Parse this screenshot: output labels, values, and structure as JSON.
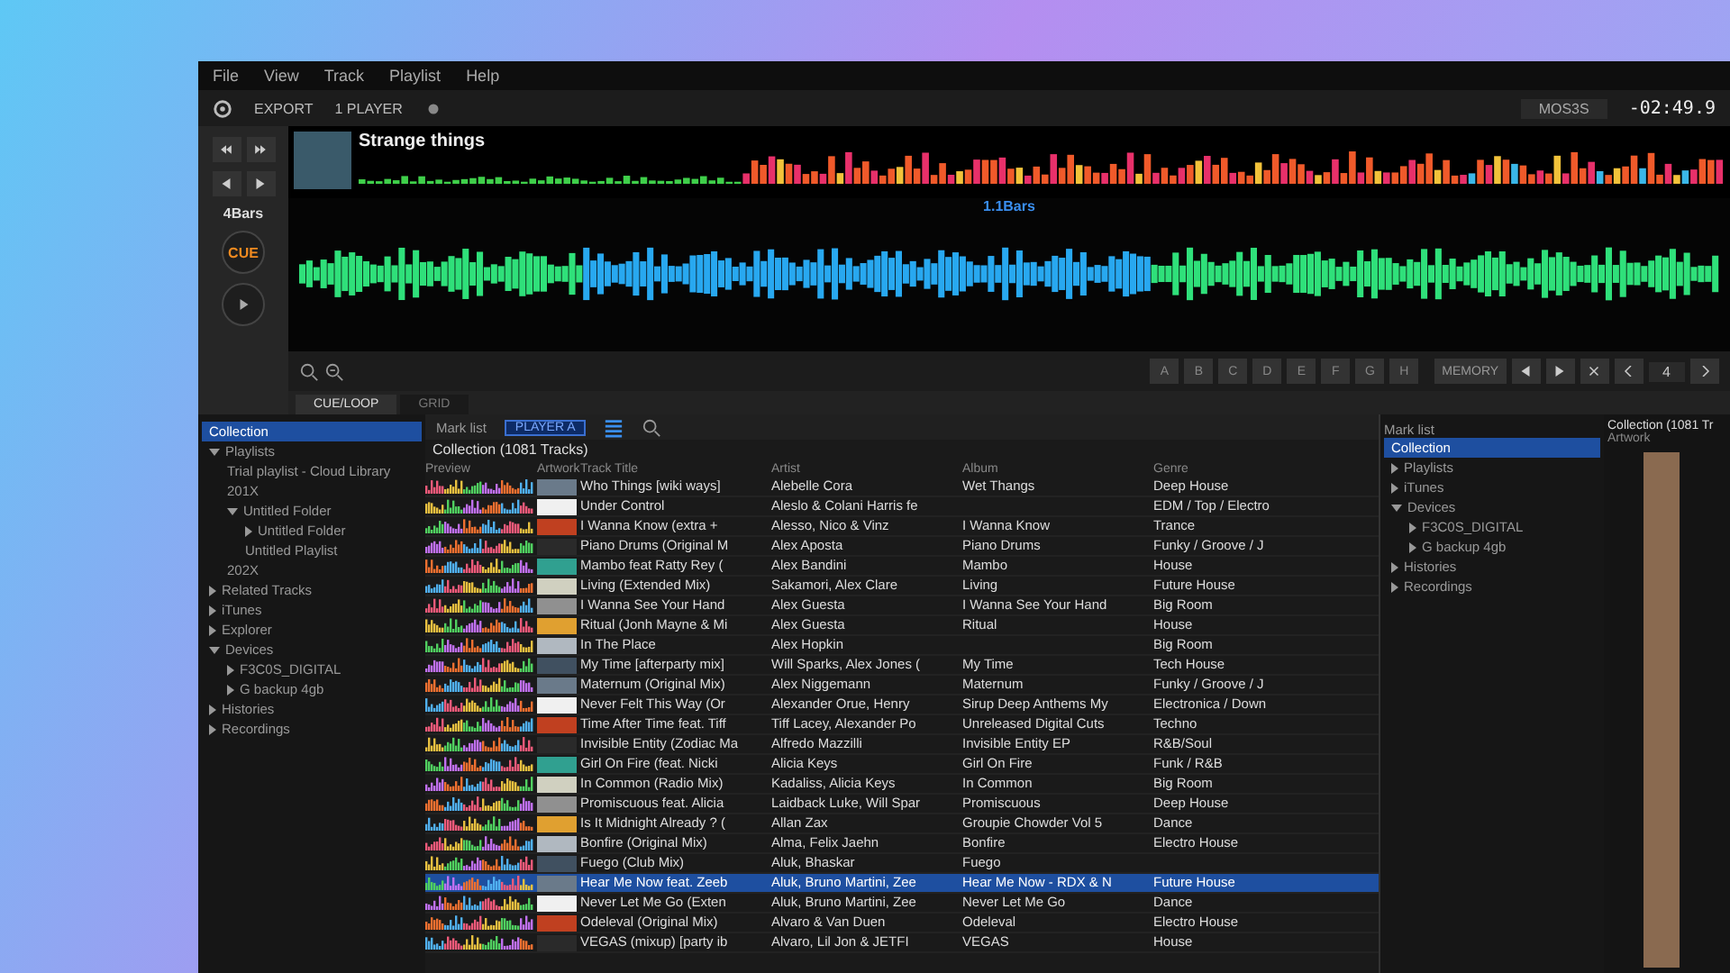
{
  "menu": [
    "File",
    "View",
    "Track",
    "Playlist",
    "Help"
  ],
  "toolbar": {
    "export": "EXPORT",
    "player": "1 PLAYER"
  },
  "deck": {
    "title": "Strange things",
    "time": "-02:49.9",
    "track_label": "MOS3S",
    "bars_marker": "1.1Bars",
    "beat_size": "4Bars",
    "cue": "CUE",
    "hot_cues": [
      "A",
      "B",
      "C",
      "D",
      "E",
      "F",
      "G",
      "H"
    ],
    "memory": "MEMORY",
    "beat_jump": "4",
    "tabs": [
      {
        "label": "CUE/LOOP",
        "selected": true
      },
      {
        "label": "GRID",
        "selected": false
      }
    ]
  },
  "left_tree": [
    {
      "label": "Collection",
      "selected": true
    },
    {
      "label": "Playlists",
      "selected": false,
      "expanded": true,
      "children": [
        {
          "label": "Trial playlist - Cloud Library",
          "selected": false
        },
        {
          "label": "201X",
          "selected": false
        },
        {
          "label": "Untitled Folder",
          "selected": false,
          "expanded": true,
          "children": [
            {
              "label": "Untitled Folder",
              "selected": false,
              "expanded": false
            },
            {
              "label": "Untitled Playlist",
              "selected": false
            }
          ]
        },
        {
          "label": "202X",
          "selected": false
        }
      ]
    },
    {
      "label": "Related Tracks",
      "selected": false,
      "expanded": false
    },
    {
      "label": "iTunes",
      "selected": false,
      "expanded": false
    },
    {
      "label": "Explorer",
      "selected": false,
      "expanded": false
    },
    {
      "label": "Devices",
      "selected": false,
      "expanded": true,
      "children": [
        {
          "label": "F3C0S_DIGITAL",
          "selected": false,
          "expanded": false
        },
        {
          "label": "G backup 4gb",
          "selected": false,
          "expanded": false
        }
      ]
    },
    {
      "label": "Histories",
      "selected": false,
      "expanded": false
    },
    {
      "label": "Recordings",
      "selected": false,
      "expanded": false
    }
  ],
  "browser": {
    "mark_label": "Mark list",
    "title": "Collection (1081 Tracks)",
    "player_select": "PLAYER A",
    "columns": [
      "Preview",
      "Artwork",
      "Track Title",
      "Artist",
      "Album",
      "Genre"
    ],
    "rows": [
      {
        "title": "Who Things [wiki ways]",
        "artist": "Alebelle Cora",
        "album": "Wet Thangs",
        "genre": "Deep House",
        "selected": false
      },
      {
        "title": "Under Control",
        "artist": "Aleslo & Colani Harris fe",
        "genre": "EDM / Top / Electro",
        "selected": false
      },
      {
        "title": "I Wanna Know (extra +",
        "artist": "Alesso, Nico & Vinz",
        "album": "I Wanna Know",
        "genre": "Trance",
        "selected": false
      },
      {
        "title": "Piano Drums (Original M",
        "artist": "Alex Aposta",
        "album": "Piano Drums",
        "genre": "Funky / Groove / J",
        "selected": false
      },
      {
        "title": "Mambo feat Ratty Rey (",
        "artist": "Alex Bandini",
        "album": "Mambo",
        "genre": "House",
        "selected": false
      },
      {
        "title": "Living (Extended Mix)",
        "artist": "Sakamori, Alex Clare",
        "album": "Living",
        "genre": "Future House",
        "selected": false
      },
      {
        "title": "I Wanna See Your Hand",
        "artist": "Alex Guesta",
        "album": "I Wanna See Your Hand",
        "genre": "Big Room",
        "selected": false
      },
      {
        "title": "Ritual (Jonh Mayne & Mi",
        "artist": "Alex Guesta",
        "album": "Ritual",
        "genre": "House",
        "selected": false
      },
      {
        "title": "In The Place",
        "artist": "Alex Hopkin",
        "genre": "Big Room",
        "selected": false
      },
      {
        "title": "My Time [afterparty mix]",
        "artist": "Will Sparks, Alex Jones (",
        "album": "My Time",
        "genre": "Tech House",
        "selected": false
      },
      {
        "title": "Maternum (Original Mix)",
        "artist": "Alex Niggemann",
        "album": "Maternum",
        "genre": "Funky / Groove / J",
        "selected": false
      },
      {
        "title": "Never Felt This Way (Or",
        "artist": "Alexander Orue, Henry",
        "album": "Sirup Deep Anthems My",
        "genre": "Electronica / Down",
        "selected": false
      },
      {
        "title": "Time After Time feat. Tiff",
        "artist": "Tiff Lacey, Alexander Po",
        "album": "Unreleased Digital Cuts",
        "genre": "Techno",
        "selected": false
      },
      {
        "title": "Invisible Entity (Zodiac Ma",
        "artist": "Alfredo Mazzilli",
        "album": "Invisible Entity EP",
        "genre": "R&B/Soul",
        "selected": false
      },
      {
        "title": "Girl On Fire (feat. Nicki",
        "artist": "Alicia Keys",
        "album": "Girl On Fire",
        "genre": "Funk / R&B",
        "selected": false
      },
      {
        "title": "In Common (Radio Mix)",
        "artist": "Kadaliss, Alicia Keys",
        "album": "In Common",
        "genre": "Big Room",
        "selected": false
      },
      {
        "title": "Promiscuous feat. Alicia",
        "artist": "Laidback Luke, Will Spar",
        "album": "Promiscuous",
        "genre": "Deep House",
        "selected": false
      },
      {
        "title": "Is It Midnight Already ? (",
        "artist": "Allan Zax",
        "album": "Groupie Chowder Vol 5",
        "genre": "Dance",
        "selected": false
      },
      {
        "title": "Bonfire (Original Mix)",
        "artist": "Alma, Felix Jaehn",
        "album": "Bonfire",
        "genre": "Electro House",
        "selected": false
      },
      {
        "title": "Fuego (Club Mix)",
        "artist": "Aluk, Bhaskar",
        "album": "Fuego",
        "selected": false
      },
      {
        "title": "Hear Me Now feat. Zeeb",
        "artist": "Aluk, Bruno Martini, Zee",
        "album": "Hear Me Now - RDX & N",
        "genre": "Future House",
        "selected": true
      },
      {
        "title": "Never Let Me Go (Exten",
        "artist": "Aluk, Bruno Martini, Zee",
        "album": "Never Let Me Go",
        "genre": "Dance",
        "selected": false
      },
      {
        "title": "Odeleval (Original Mix)",
        "artist": "Alvaro & Van Duen",
        "album": "Odeleval",
        "genre": "Electro House",
        "selected": false
      },
      {
        "title": "VEGAS (mixup) [party ib",
        "artist": "Alvaro, Lil Jon & JETFI",
        "album": "VEGAS",
        "genre": "House",
        "selected": false
      }
    ]
  },
  "right_tree": {
    "mark_label": "Mark list",
    "items": [
      {
        "label": "Collection",
        "selected": true
      },
      {
        "label": "Playlists",
        "selected": false,
        "expanded": false
      },
      {
        "label": "iTunes",
        "selected": false,
        "expanded": false
      },
      {
        "label": "Devices",
        "selected": false,
        "expanded": true,
        "children": [
          {
            "label": "F3C0S_DIGITAL",
            "selected": false,
            "expanded": false
          },
          {
            "label": "G backup 4gb",
            "selected": false,
            "expanded": false
          }
        ]
      },
      {
        "label": "Histories",
        "selected": false,
        "expanded": false
      },
      {
        "label": "Recordings",
        "selected": false,
        "expanded": false
      }
    ]
  },
  "right_browser": {
    "title": "Collection (1081 Tr",
    "column": "Artwork"
  }
}
